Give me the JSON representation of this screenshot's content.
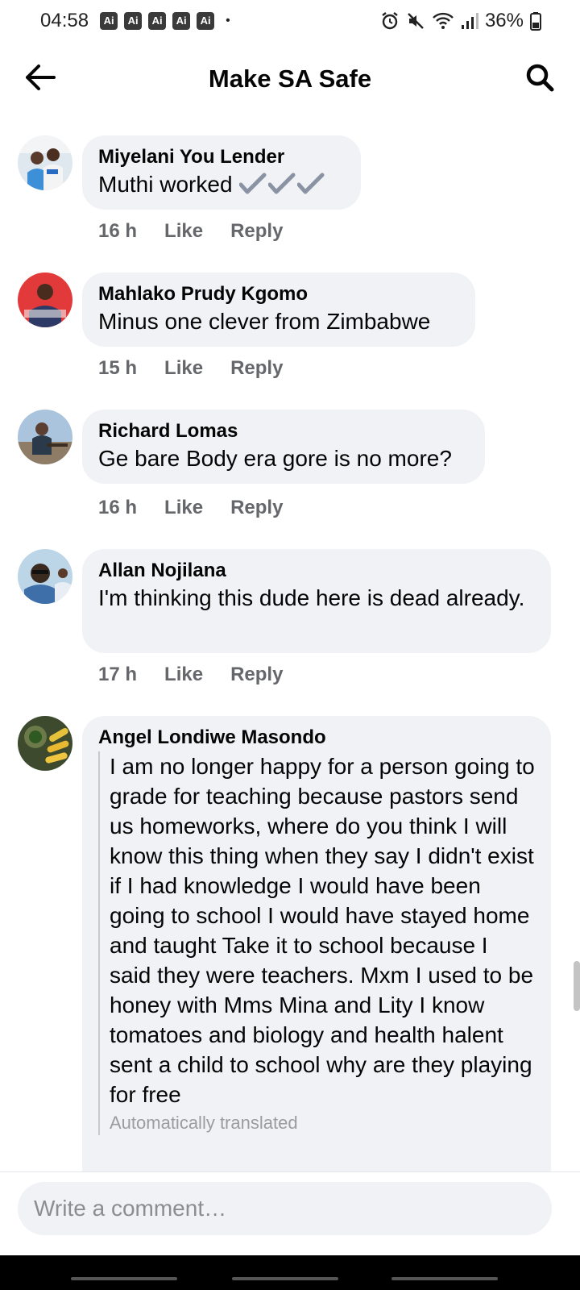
{
  "status_bar": {
    "time": "04:58",
    "ai_badges": [
      "Ai",
      "Ai",
      "Ai",
      "Ai",
      "Ai"
    ],
    "dot": "•",
    "battery": "36%",
    "icons": [
      "alarm-icon",
      "mute-icon",
      "wifi-icon",
      "signal-icon",
      "battery-icon"
    ]
  },
  "header": {
    "title": "Make SA Safe",
    "back_icon": "arrow-left-icon",
    "search_icon": "search-icon"
  },
  "comments": [
    {
      "author": "Miyelani You Lender",
      "text": "Muthi worked",
      "suffix_icon": "checkmark-icon x3",
      "time": "16 h",
      "like": "Like",
      "reply": "Reply"
    },
    {
      "author": "Mahlako Prudy Kgomo",
      "text": "Minus one clever from Zimbabwe",
      "time": "15 h",
      "like": "Like",
      "reply": "Reply"
    },
    {
      "author": "Richard Lomas",
      "text": "Ge bare Body era gore is no more?",
      "time": "16 h",
      "like": "Like",
      "reply": "Reply"
    },
    {
      "author": "Allan Nojilana",
      "text": "I'm thinking this dude here is dead already.",
      "time": "17 h",
      "like": "Like",
      "reply": "Reply"
    },
    {
      "author": "Angel Londiwe Masondo",
      "text": "I am no longer happy for a person going to grade for teaching because pastors send us homeworks, where do you think I will know this thing when they say I didn't exist if I had knowledge I would have been going to school I would have stayed home and taught Take it to school because I said they were teachers. Mxm I used to be honey with Mms Mina and Lity I know tomatoes and biology and health halent sent a child to school why are they playing for free",
      "translated_note": "Automatically translated"
    }
  ],
  "composer": {
    "placeholder": "Write a comment…"
  },
  "colors": {
    "bubble": "#f0f2f5",
    "meta": "#65676b",
    "text": "#050505"
  }
}
